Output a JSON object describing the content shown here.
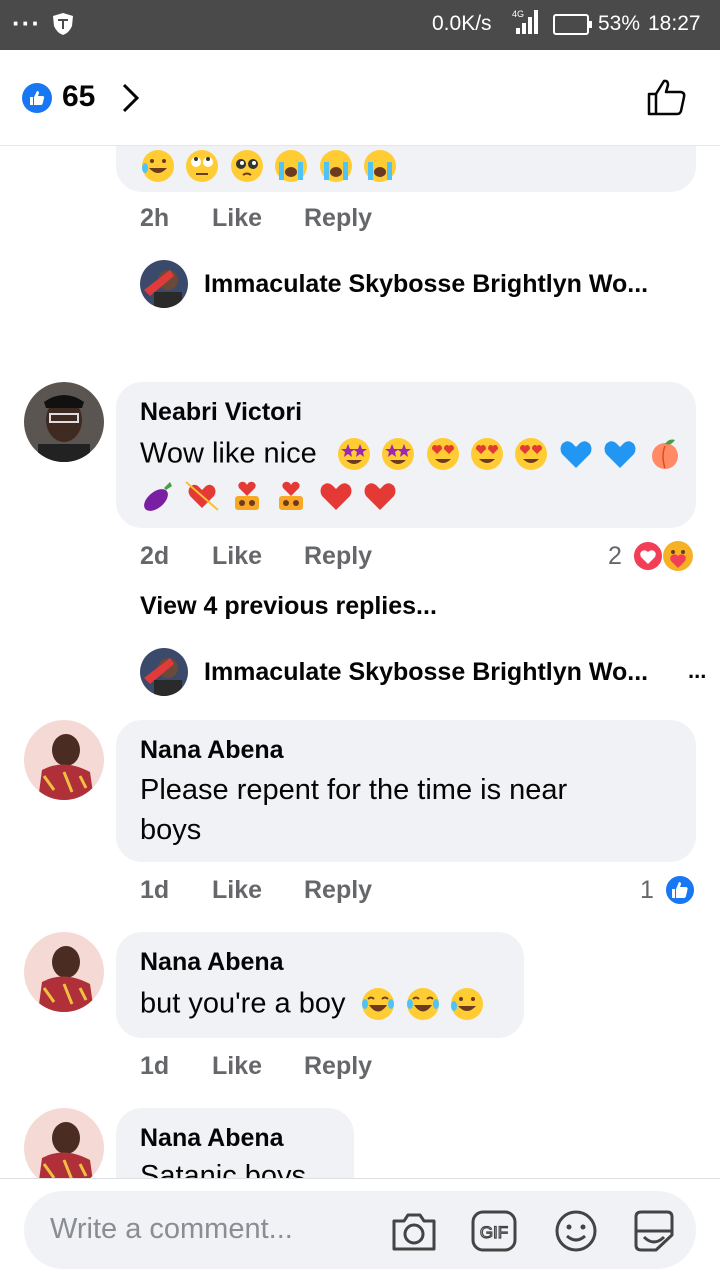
{
  "status": {
    "speed": "0.0K/s",
    "network": "4G",
    "battery": "53%",
    "time": "18:27"
  },
  "header": {
    "like_count": "65"
  },
  "top_comment": {
    "time": "2h",
    "like": "Like",
    "reply": "Reply"
  },
  "reply_preview_1": {
    "name": "Immaculate Skybosse Brightlyn Wo..."
  },
  "comment_neabri": {
    "name": "Neabri Victori",
    "text": "Wow like nice",
    "time": "2d",
    "like": "Like",
    "reply": "Reply",
    "reaction_count": "2"
  },
  "view_previous": "View 4 previous replies...",
  "reply_preview_2": {
    "name": "Immaculate Skybosse Brightlyn Wo...",
    "more": "..."
  },
  "comment_nana_1": {
    "name": "Nana Abena",
    "line1": "Please repent for the time is near",
    "line2": "boys",
    "time": "1d",
    "like": "Like",
    "reply": "Reply",
    "reaction_count": "1"
  },
  "comment_nana_2": {
    "name": "Nana Abena",
    "text": "but you're a boy",
    "time": "1d",
    "like": "Like",
    "reply": "Reply"
  },
  "comment_nana_3": {
    "name": "Nana Abena",
    "text": "Satanic boys"
  },
  "composer": {
    "placeholder": "Write a comment..."
  },
  "colors": {
    "accent": "#1877f2",
    "bubble": "#f0f2f5",
    "meta": "#65676b",
    "love": "#f33e58"
  },
  "icons": [
    "like-icon",
    "chevron-right-icon",
    "thumbs-up-outline-icon",
    "camera-icon",
    "gif-icon",
    "smiley-icon",
    "sticker-icon"
  ]
}
